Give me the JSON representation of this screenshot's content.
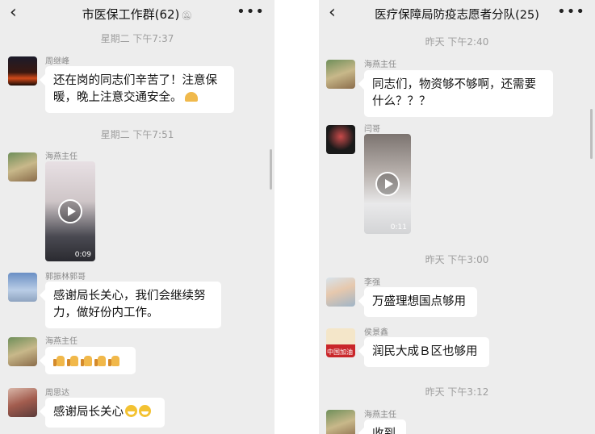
{
  "left_chat": {
    "title": "市医保工作群(62)",
    "timestamps": [
      "星期二 下午7:37",
      "星期二 下午7:51"
    ],
    "messages": [
      {
        "sender": "周继峰",
        "text": "还在岗的同志们辛苦了！注意保暖，晚上注意交通安全。"
      },
      {
        "sender": "海燕主任",
        "video_duration": "0:09"
      },
      {
        "sender": "郭振林郭哥",
        "text": "感谢局长关心，我们会继续努力，做好份内工作。"
      },
      {
        "sender": "海燕主任",
        "emoji": "thumbs-up x5"
      },
      {
        "sender": "周思达",
        "text": "感谢局长关心"
      }
    ]
  },
  "right_chat": {
    "title": "医疗保障局防疫志愿者分队(25)",
    "timestamps": [
      "昨天 下午2:40",
      "昨天 下午3:00",
      "昨天 下午3:12"
    ],
    "messages": [
      {
        "sender": "海燕主任",
        "text": "同志们，物资够不够啊，还需要什么？？？"
      },
      {
        "sender": "闫哥",
        "video_duration": "0:11"
      },
      {
        "sender": "李强",
        "text": "万盛理想国点够用"
      },
      {
        "sender": "侯景鑫",
        "text": "润民大成Ｂ区也够用",
        "avatar_text": "中国加油"
      },
      {
        "sender": "海燕主任",
        "text": "收到"
      }
    ]
  },
  "icons": {
    "back": "‹",
    "more": "•••"
  }
}
